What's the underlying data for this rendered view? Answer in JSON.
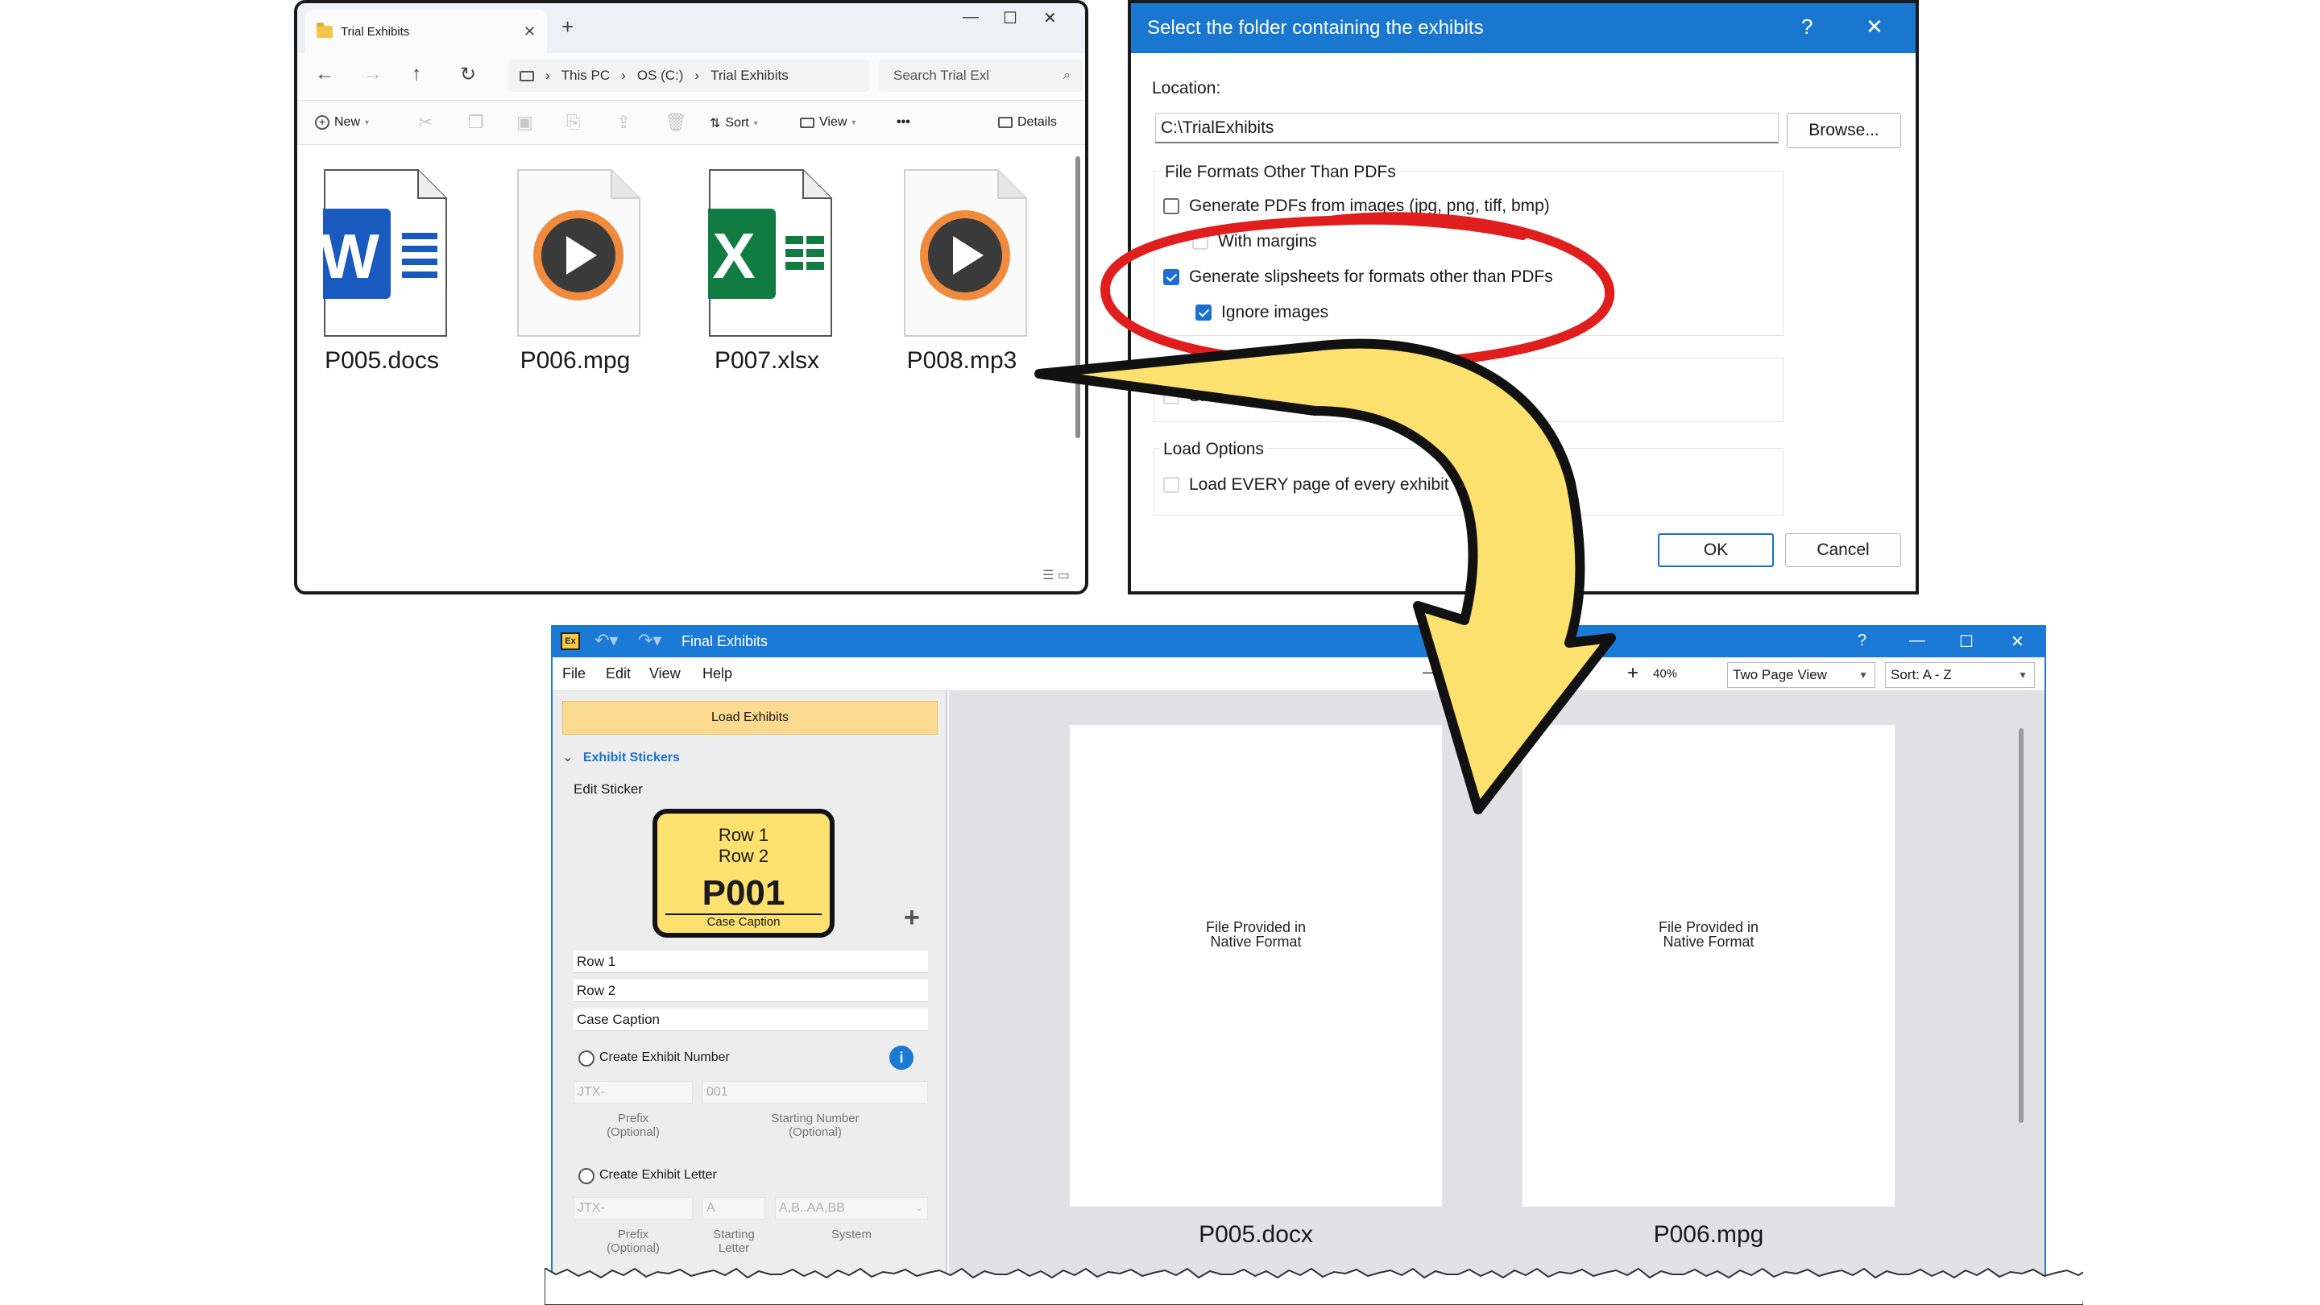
{
  "explorer": {
    "tab_title": "Trial Exhibits",
    "close": "✕",
    "new_tab": "+",
    "min": "—",
    "max": "☐",
    "win_close": "✕",
    "breadcrumb": [
      "This PC",
      "OS (C:)",
      "Trial Exhibits"
    ],
    "breadcrumb_sep": "›",
    "search_placeholder": "Search Trial Exl",
    "toolbar": {
      "new_label": "New",
      "sort_label": "Sort",
      "view_label": "View",
      "more_label": "•••",
      "details_label": "Details"
    },
    "files": [
      {
        "name": "P005.docs",
        "icon": "word-icon",
        "badge": "W"
      },
      {
        "name": "P006.mpg",
        "icon": "media-play-icon"
      },
      {
        "name": "P007.xlsx",
        "icon": "excel-icon",
        "badge": "X"
      },
      {
        "name": "P008.mp3",
        "icon": "media-play-icon"
      }
    ],
    "colors": {
      "word": "#185abd",
      "excel": "#107c41",
      "media_ring": "#f08a3c"
    }
  },
  "dialog": {
    "title": "Select the folder containing the exhibits",
    "help": "?",
    "close": "✕",
    "location_label": "Location:",
    "location_value": "C:\\TrialExhibits",
    "browse_label": "Browse...",
    "group_title": "File Formats Other Than PDFs",
    "opt_generate_pdfs": "Generate PDFs from images (jpg, png, tiff, bmp)",
    "opt_with_margins": "With margins",
    "opt_slipsheets": "Generate slipsheets for formats other than PDFs",
    "opt_ignore_images": "Ignore images",
    "opt_shrink": "Shrink oversized PDFs",
    "load_options_title": "Load Options",
    "opt_load_every": "Load EVERY page of every exhibit",
    "ok_label": "OK",
    "cancel_label": "Cancel",
    "accent": "#1977d0",
    "highlight_color": "#e01e1e"
  },
  "app": {
    "title": "Final Exhibits",
    "app_icon": "Ex",
    "help": "?",
    "min": "—",
    "max": "☐",
    "close": "✕",
    "menu": [
      "File",
      "Edit",
      "View",
      "Help"
    ],
    "zoom_minus": "—",
    "zoom_plus": "+",
    "zoom_value": "40%",
    "view_mode": "Two Page View",
    "sort_mode": "Sort: A - Z",
    "load_button": "Load Exhibits",
    "section_title": "Exhibit Stickers",
    "edit_sticker_label": "Edit Sticker",
    "sticker": {
      "row1": "Row 1",
      "row2": "Row 2",
      "number": "P001",
      "caption": "Case Caption"
    },
    "add_icon": "+",
    "sticker_fields": [
      "Row 1",
      "Row 2",
      "Case Caption"
    ],
    "create_number_label": "Create Exhibit Number",
    "info_icon": "i",
    "prefix_value": "JTX-",
    "start_number_value": "001",
    "prefix_caption": "Prefix\n(Optional)",
    "start_number_caption": "Starting Number\n(Optional)",
    "create_letter_label": "Create Exhibit Letter",
    "letter_prefix_value": "JTX-",
    "letter_start_value": "A",
    "letter_system_value": "A,B..AA,BB",
    "letter_prefix_caption": "Prefix\n(Optional)",
    "letter_start_caption": "Starting\nLetter",
    "letter_system_caption": "System",
    "pages": [
      {
        "text": "File Provided in\nNative Format",
        "caption": "P005.docx"
      },
      {
        "text": "File Provided in\nNative Format",
        "caption": "P006.mpg"
      }
    ],
    "accent": "#1a7ad6",
    "load_button_color": "#fbdb8f",
    "sticker_color": "#fde16e"
  }
}
